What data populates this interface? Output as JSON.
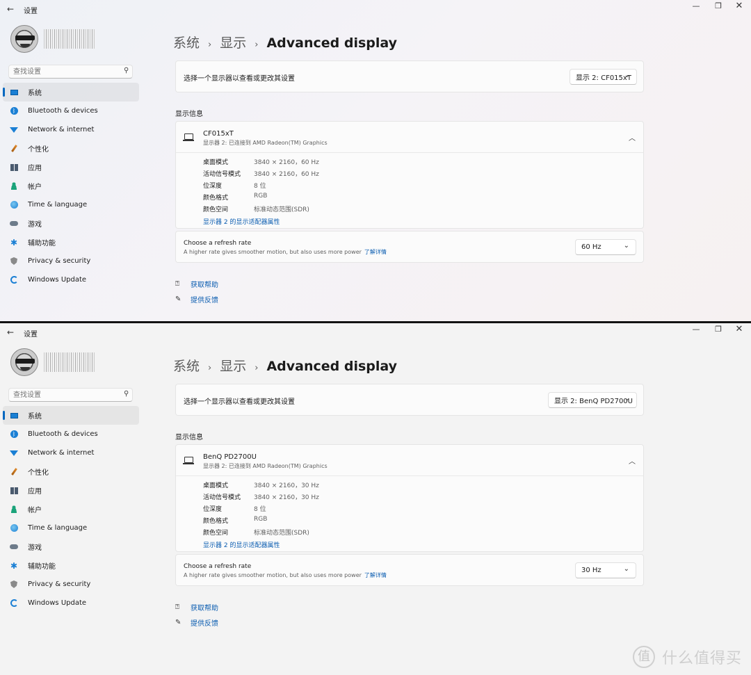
{
  "windows": [
    {
      "app_title": "设置",
      "search_placeholder": "查找设置",
      "nav": [
        {
          "label": "系统",
          "icon": "system-icon",
          "active": true
        },
        {
          "label": "Bluetooth & devices",
          "icon": "bluetooth-icon"
        },
        {
          "label": "Network & internet",
          "icon": "wifi-icon"
        },
        {
          "label": "个性化",
          "icon": "brush-icon"
        },
        {
          "label": "应用",
          "icon": "apps-icon"
        },
        {
          "label": "帐户",
          "icon": "account-icon"
        },
        {
          "label": "Time & language",
          "icon": "globe-icon"
        },
        {
          "label": "游戏",
          "icon": "gamepad-icon"
        },
        {
          "label": "辅助功能",
          "icon": "accessibility-icon"
        },
        {
          "label": "Privacy & security",
          "icon": "shield-icon"
        },
        {
          "label": "Windows Update",
          "icon": "update-icon"
        }
      ],
      "breadcrumb": [
        "系统",
        "显示",
        "Advanced display"
      ],
      "select_label": "选择一个显示器以查看或更改其设置",
      "display_selected": "显示 2: CF015xT",
      "section_label": "显示信息",
      "monitor_name": "CF015xT",
      "monitor_sub": "显示器 2: 已连接到 AMD Radeon(TM) Graphics",
      "info": [
        {
          "key": "桌面模式",
          "value": "3840 × 2160，60 Hz"
        },
        {
          "key": "活动信号模式",
          "value": "3840 × 2160，60 Hz"
        },
        {
          "key": "位深度",
          "value": "8 位"
        },
        {
          "key": "颜色格式",
          "value": "RGB"
        },
        {
          "key": "颜色空间",
          "value": "标准动态范围(SDR)"
        }
      ],
      "adapter_link": "显示器 2 的显示适配器属性",
      "refresh_title": "Choose a refresh rate",
      "refresh_sub": "A higher rate gives smoother motion, but also uses more power",
      "learn_more": "了解详情",
      "refresh_value": "60 Hz",
      "help": "获取帮助",
      "feedback": "提供反馈"
    },
    {
      "app_title": "设置",
      "search_placeholder": "查找设置",
      "nav": [
        {
          "label": "系统",
          "icon": "system-icon",
          "active": true
        },
        {
          "label": "Bluetooth & devices",
          "icon": "bluetooth-icon"
        },
        {
          "label": "Network & internet",
          "icon": "wifi-icon"
        },
        {
          "label": "个性化",
          "icon": "brush-icon"
        },
        {
          "label": "应用",
          "icon": "apps-icon"
        },
        {
          "label": "帐户",
          "icon": "account-icon"
        },
        {
          "label": "Time & language",
          "icon": "globe-icon"
        },
        {
          "label": "游戏",
          "icon": "gamepad-icon"
        },
        {
          "label": "辅助功能",
          "icon": "accessibility-icon"
        },
        {
          "label": "Privacy & security",
          "icon": "shield-icon"
        },
        {
          "label": "Windows Update",
          "icon": "update-icon"
        }
      ],
      "breadcrumb": [
        "系统",
        "显示",
        "Advanced display"
      ],
      "select_label": "选择一个显示器以查看或更改其设置",
      "display_selected": "显示 2: BenQ PD2700U",
      "section_label": "显示信息",
      "monitor_name": "BenQ PD2700U",
      "monitor_sub": "显示器 2: 已连接到 AMD Radeon(TM) Graphics",
      "info": [
        {
          "key": "桌面模式",
          "value": "3840 × 2160，30 Hz"
        },
        {
          "key": "活动信号模式",
          "value": "3840 × 2160，30 Hz"
        },
        {
          "key": "位深度",
          "value": "8 位"
        },
        {
          "key": "颜色格式",
          "value": "RGB"
        },
        {
          "key": "颜色空间",
          "value": "标准动态范围(SDR)"
        }
      ],
      "adapter_link": "显示器 2 的显示适配器属性",
      "refresh_title": "Choose a refresh rate",
      "refresh_sub": "A higher rate gives smoother motion, but also uses more power",
      "learn_more": "了解详情",
      "refresh_value": "30 Hz",
      "help": "获取帮助",
      "feedback": "提供反馈"
    }
  ],
  "watermark": {
    "mark": "值",
    "text": "什么值得买"
  },
  "colors": {
    "accent": "#0067c0",
    "link": "#0a5cb0"
  }
}
